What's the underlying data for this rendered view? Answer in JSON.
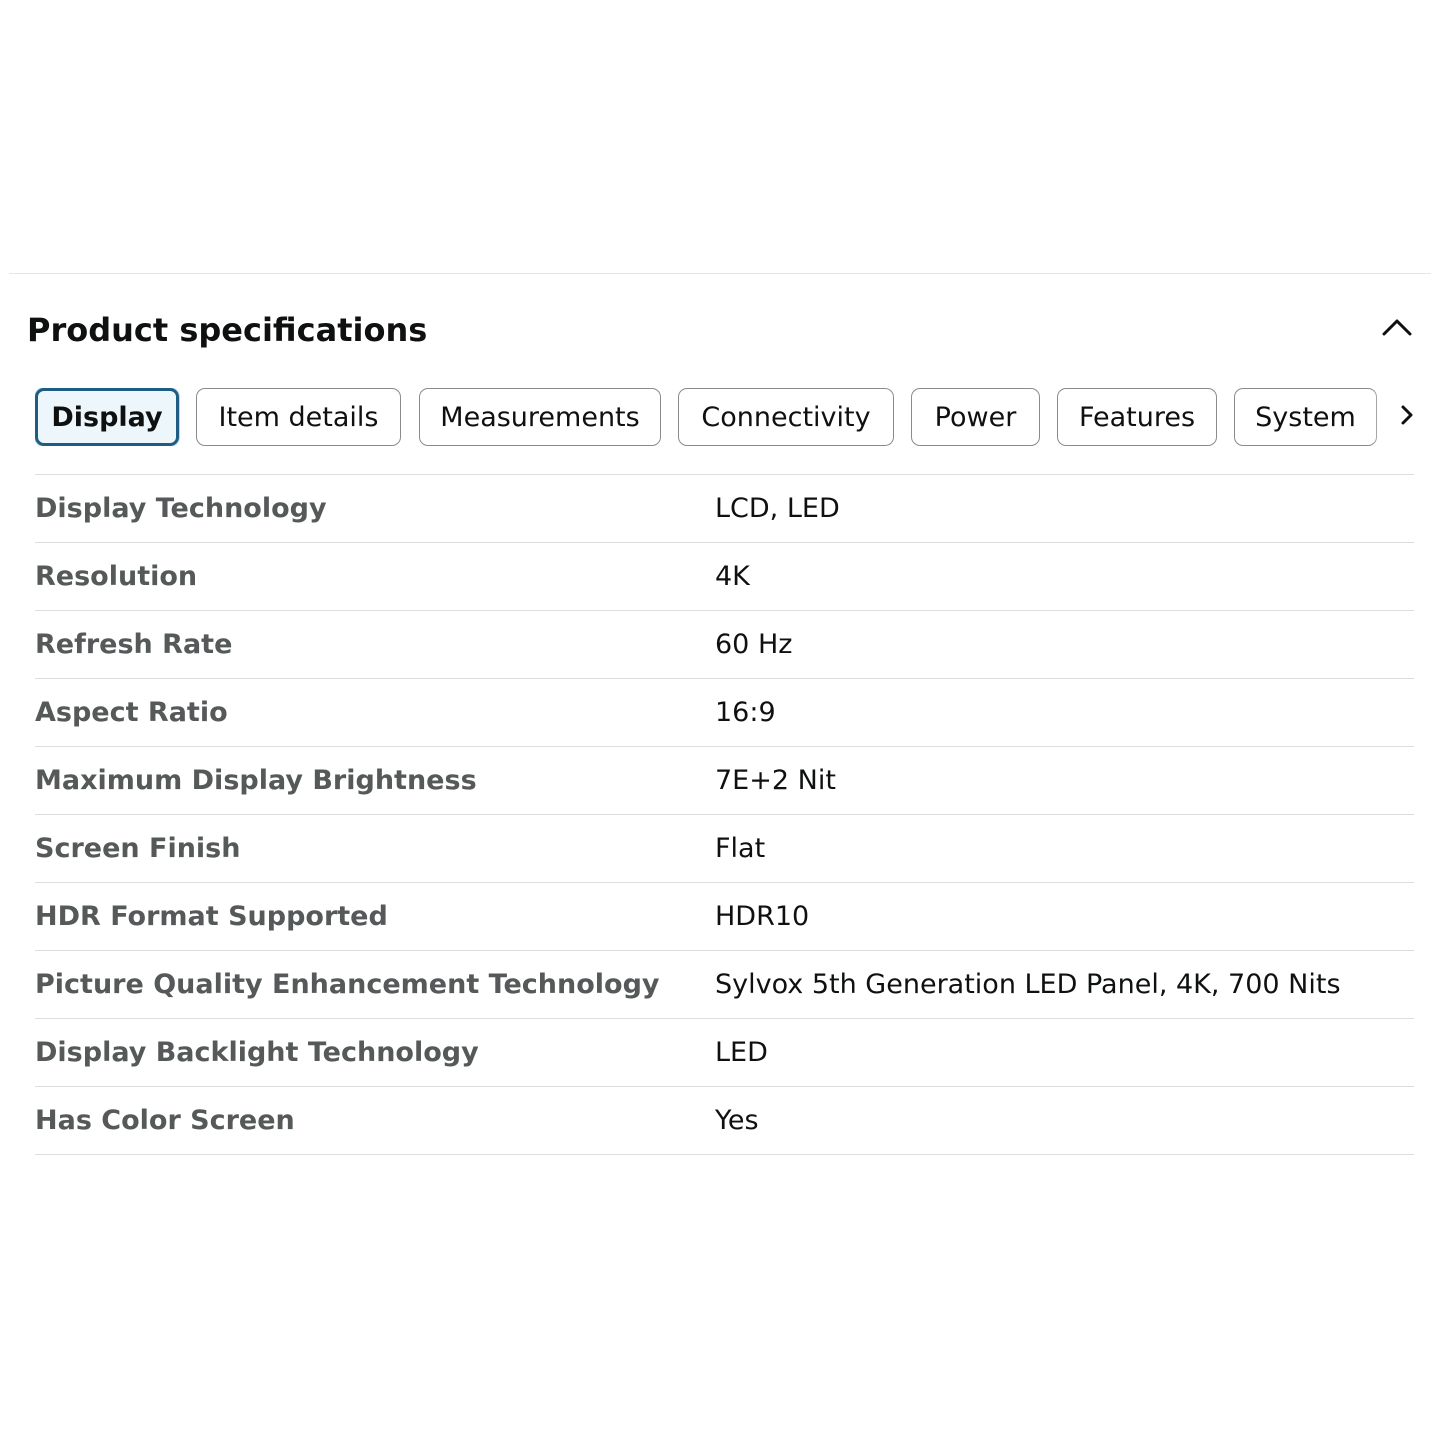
{
  "section": {
    "title": "Product specifications",
    "collapse_icon": "chevron-up-icon"
  },
  "tabs": [
    {
      "label": "Display",
      "active": true
    },
    {
      "label": "Item details",
      "active": false
    },
    {
      "label": "Measurements",
      "active": false
    },
    {
      "label": "Connectivity",
      "active": false
    },
    {
      "label": "Power",
      "active": false
    },
    {
      "label": "Features",
      "active": false
    },
    {
      "label": "System",
      "active": false
    }
  ],
  "tabs_next_icon": "chevron-right-icon",
  "specs": [
    {
      "label": "Display Technology",
      "value": "LCD, LED"
    },
    {
      "label": "Resolution",
      "value": "4K"
    },
    {
      "label": "Refresh Rate",
      "value": "60 Hz"
    },
    {
      "label": "Aspect Ratio",
      "value": "16:9"
    },
    {
      "label": "Maximum Display Brightness",
      "value": "7E+2 Nit"
    },
    {
      "label": "Screen Finish",
      "value": "Flat"
    },
    {
      "label": "HDR Format Supported",
      "value": "HDR10"
    },
    {
      "label": "Picture Quality Enhancement Technology",
      "value": "Sylvox 5th Generation LED Panel, 4K, 700 Nits"
    },
    {
      "label": "Display Backlight Technology",
      "value": "LED"
    },
    {
      "label": "Has Color Screen",
      "value": "Yes"
    }
  ],
  "colors": {
    "active_tab_border": "#1f5c84",
    "active_tab_background": "#edf7fb",
    "label_text": "#565959",
    "value_text": "#0f1111",
    "divider": "#dddddd"
  }
}
